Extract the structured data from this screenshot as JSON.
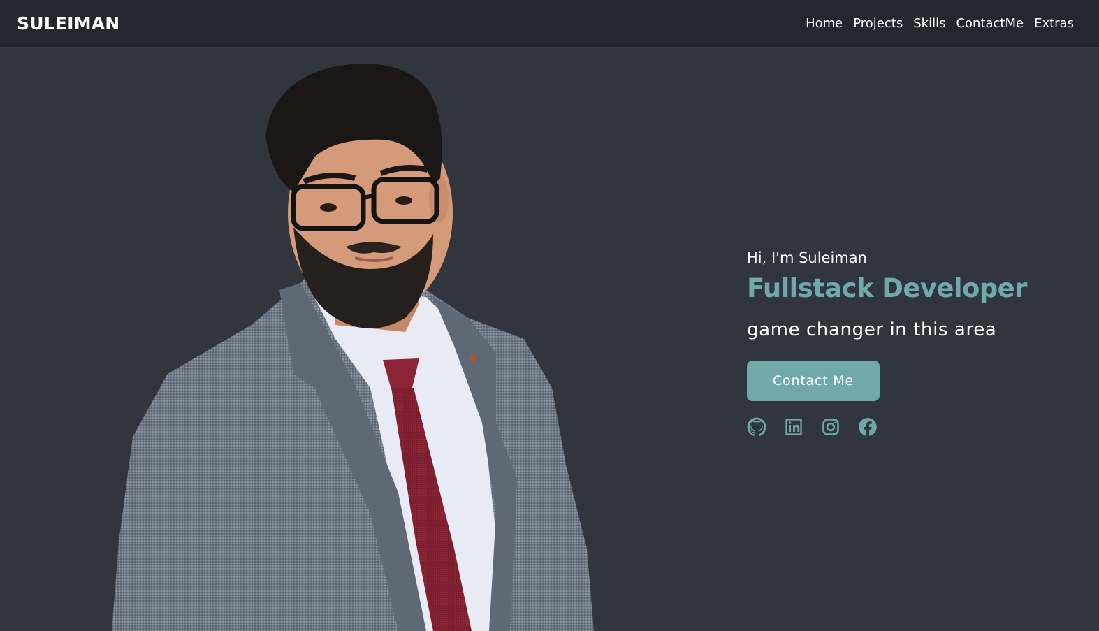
{
  "header": {
    "brand": "SULEIMAN",
    "nav": [
      "Home",
      "Projects",
      "Skills",
      "ContactMe",
      "Extras"
    ]
  },
  "hero": {
    "greeting": "Hi, I'm Suleiman",
    "role": "Fullstack Developer",
    "tagline": "game changer in this area",
    "cta_label": "Contact Me",
    "photo": "portrait-photo",
    "socials": [
      "github-icon",
      "linkedin-icon",
      "instagram-icon",
      "facebook-icon"
    ]
  },
  "colors": {
    "navbar_bg": "#23272f",
    "page_bg": "#31353e",
    "accent": "#6fa9a9",
    "text": "#ffffff"
  }
}
